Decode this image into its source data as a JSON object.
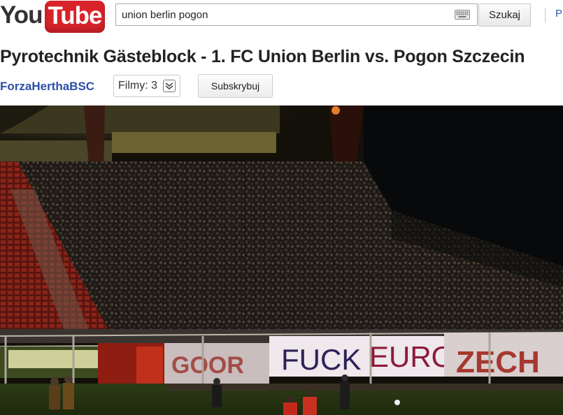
{
  "header": {
    "logo_you": "You",
    "logo_tube": "Tube",
    "search_value": "union berlin pogon",
    "search_button": "Szukaj",
    "upload_link": "P"
  },
  "video": {
    "title": "Pyrotechnik Gästeblock - 1. FC Union Berlin vs. Pogon Szczecin",
    "banner_text_1": "FUCK",
    "banner_text_2": "EURO",
    "banner_text_3": "ZECH",
    "banner_text_4": "GOOR"
  },
  "channel": {
    "name": "ForzaHerthaBSC",
    "videos_label": "Filmy: 3",
    "subscribe_label": "Subskrybuj"
  },
  "icons": {
    "keyboard": "keyboard-icon",
    "expand": "chevron-down-icon"
  },
  "colors": {
    "brand_red": "#d9232a",
    "link_blue": "#2b4fa8"
  }
}
